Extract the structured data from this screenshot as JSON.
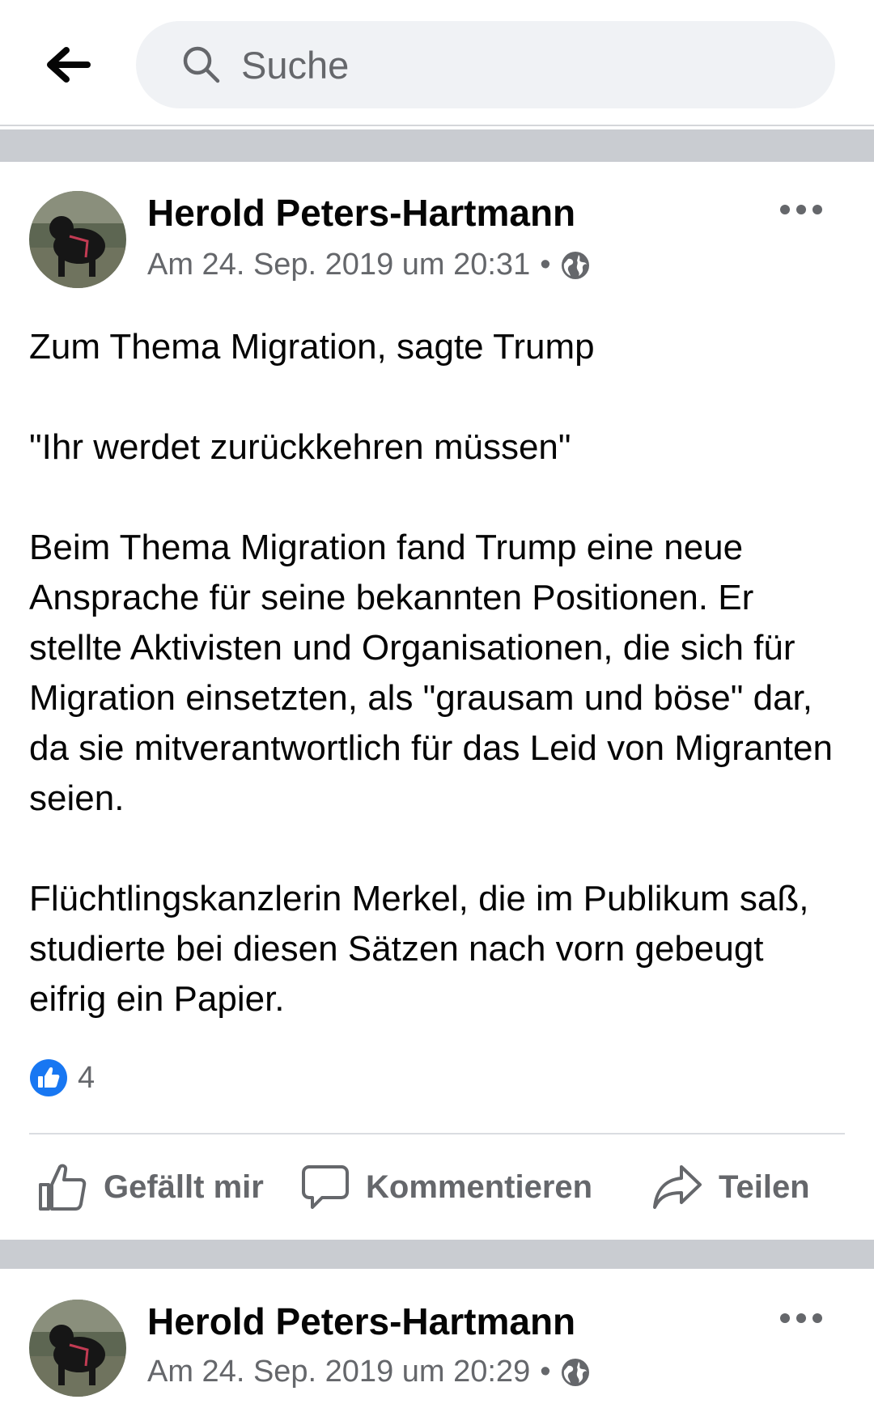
{
  "search": {
    "placeholder": "Suche"
  },
  "posts": [
    {
      "author": "Herold Peters-Hartmann",
      "timestamp": "Am 24. Sep. 2019 um 20:31",
      "separator": "•",
      "privacy_icon": "globe-icon",
      "paragraphs": [
        "Zum Thema Migration, sagte Trump",
        "\"Ihr werdet zurückkehren müssen\"",
        "Beim Thema Migration fand Trump eine neue Ansprache für seine bekannten Positionen. Er stellte Aktivisten und Organisationen, die sich für Migration einsetzten, als \"grausam und böse\" dar, da sie mitverantwortlich für das Leid von Migranten seien.",
        "Flüchtlingskanzlerin Merkel, die im Publikum saß, studierte bei diesen Sätzen nach vorn gebeugt eifrig ein Papier."
      ],
      "reactions": {
        "icon": "like-icon",
        "count": "4"
      },
      "actions": {
        "like": "Gefällt mir",
        "comment": "Kommentieren",
        "share": "Teilen"
      }
    },
    {
      "author": "Herold Peters-Hartmann",
      "timestamp": "Am 24. Sep. 2019 um 20:29",
      "separator": "•",
      "privacy_icon": "globe-icon"
    }
  ],
  "colors": {
    "accent": "#1877f2",
    "secondary_text": "#65676b",
    "divider": "#c9ccd1",
    "search_bg": "#f0f2f5"
  }
}
